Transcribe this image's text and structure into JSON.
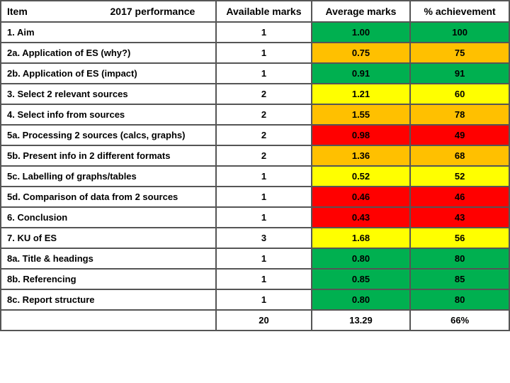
{
  "headers": {
    "col1": "Item",
    "col2": "2017 performance",
    "col3": "Available marks",
    "col4": "Average marks",
    "col5": "% achievement"
  },
  "rows": [
    {
      "item": "1. Aim",
      "available": "1",
      "average": "1.00",
      "pct": "100",
      "avg_color": "green",
      "pct_color": "green"
    },
    {
      "item": "2a. Application of ES (why?)",
      "available": "1",
      "average": "0.75",
      "pct": "75",
      "avg_color": "orange",
      "pct_color": "orange"
    },
    {
      "item": "2b. Application of ES (impact)",
      "available": "1",
      "average": "0.91",
      "pct": "91",
      "avg_color": "green",
      "pct_color": "green"
    },
    {
      "item": "3. Select 2 relevant sources",
      "available": "2",
      "average": "1.21",
      "pct": "60",
      "avg_color": "yellow",
      "pct_color": "yellow"
    },
    {
      "item": "4. Select info from sources",
      "available": "2",
      "average": "1.55",
      "pct": "78",
      "avg_color": "orange",
      "pct_color": "orange"
    },
    {
      "item": "5a. Processing 2 sources (calcs, graphs)",
      "available": "2",
      "average": "0.98",
      "pct": "49",
      "avg_color": "red",
      "pct_color": "red"
    },
    {
      "item": "5b. Present info in 2 different formats",
      "available": "2",
      "average": "1.36",
      "pct": "68",
      "avg_color": "orange",
      "pct_color": "orange"
    },
    {
      "item": "5c. Labelling of graphs/tables",
      "available": "1",
      "average": "0.52",
      "pct": "52",
      "avg_color": "yellow",
      "pct_color": "yellow"
    },
    {
      "item": "5d. Comparison of data from 2 sources",
      "available": "1",
      "average": "0.46",
      "pct": "46",
      "avg_color": "red",
      "pct_color": "red"
    },
    {
      "item": "6. Conclusion",
      "available": "1",
      "average": "0.43",
      "pct": "43",
      "avg_color": "red",
      "pct_color": "red"
    },
    {
      "item": "7. KU of ES",
      "available": "3",
      "average": "1.68",
      "pct": "56",
      "avg_color": "yellow",
      "pct_color": "yellow"
    },
    {
      "item": "8a. Title & headings",
      "available": "1",
      "average": "0.80",
      "pct": "80",
      "avg_color": "green",
      "pct_color": "green"
    },
    {
      "item": "8b. Referencing",
      "available": "1",
      "average": "0.85",
      "pct": "85",
      "avg_color": "green",
      "pct_color": "green"
    },
    {
      "item": "8c. Report structure",
      "available": "1",
      "average": "0.80",
      "pct": "80",
      "avg_color": "green",
      "pct_color": "green"
    }
  ],
  "total": {
    "available": "20",
    "average": "13.29",
    "pct": "66%"
  }
}
